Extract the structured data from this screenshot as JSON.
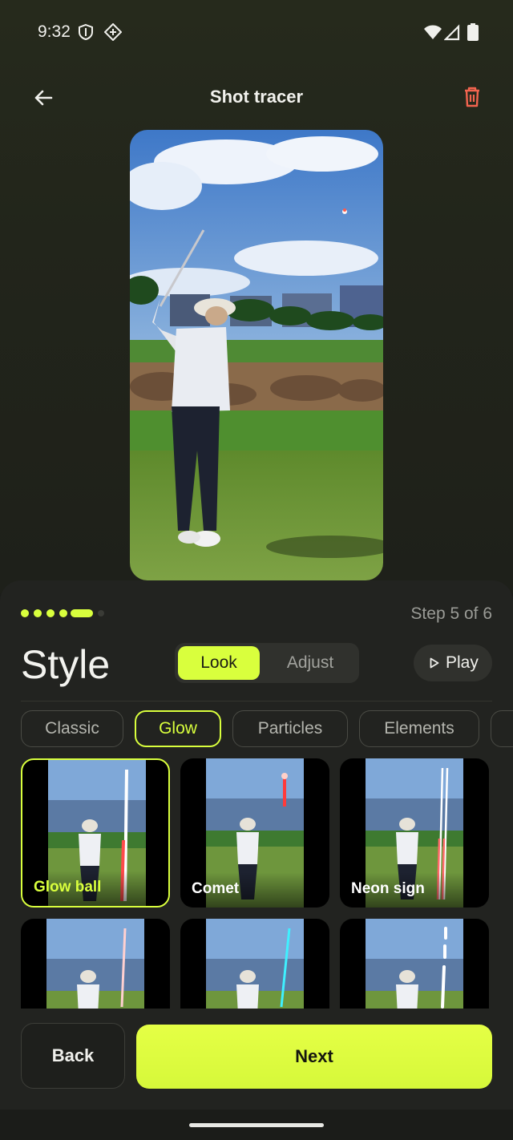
{
  "status": {
    "time": "9:32"
  },
  "header": {
    "title": "Shot tracer"
  },
  "progress": {
    "current_step": 5,
    "total_steps": 6,
    "step_text": "Step 5 of 6"
  },
  "section": {
    "title": "Style"
  },
  "segmented": {
    "look": "Look",
    "adjust": "Adjust",
    "selected": "Look"
  },
  "play": {
    "label": "Play"
  },
  "chips": [
    {
      "label": "Classic",
      "active": false
    },
    {
      "label": "Glow",
      "active": true
    },
    {
      "label": "Particles",
      "active": false
    },
    {
      "label": "Elements",
      "active": false
    }
  ],
  "styles": [
    {
      "label": "Glow ball",
      "selected": true,
      "trail_color": "#ff4a4a"
    },
    {
      "label": "Comet",
      "selected": false,
      "trail_color": "#ff3b3b"
    },
    {
      "label": "Neon sign",
      "selected": false,
      "trail_color": "#ff6a6a"
    },
    {
      "label": "",
      "selected": false,
      "trail_color": "#ff8080"
    },
    {
      "label": "",
      "selected": false,
      "trail_color": "#3ff0ff"
    },
    {
      "label": "",
      "selected": false,
      "trail_color": "#ffffff"
    }
  ],
  "footer": {
    "back_label": "Back",
    "next_label": "Next"
  },
  "colors": {
    "accent": "#d9ff3d",
    "danger": "#f2644f"
  }
}
